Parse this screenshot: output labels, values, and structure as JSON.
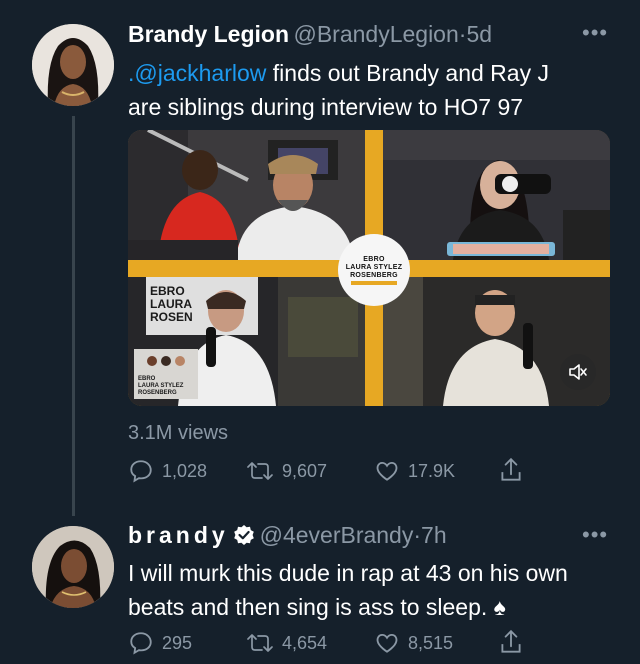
{
  "tweet1": {
    "name": "Brandy Legion",
    "handle": "@BrandyLegion",
    "separator": "·",
    "time": "5d",
    "mention": ".@jackharlow",
    "text_line1_rest": " finds out Brandy and Ray J",
    "text_line2": "are siblings during interview to HO7 97",
    "media": {
      "logo_lines": [
        "EBRO",
        "LAURA STYLEZ",
        "ROSENBERG"
      ],
      "sign_lines": [
        "EBRO",
        "LAURA",
        "ROSEN"
      ],
      "small_sign_lines": [
        "EBRO",
        "LAURA STYLEZ",
        "ROSENBERG"
      ]
    },
    "views": "3.1M views",
    "stats": {
      "replies": "1,028",
      "retweets": "9,607",
      "likes": "17.9K"
    }
  },
  "tweet2": {
    "name": "brandy",
    "handle": "@4everBrandy",
    "separator": "·",
    "time": "7h",
    "text_line1": "I will murk this dude in rap at 43 on his own",
    "text_line2": "beats and then sing is ass to sleep. ♠",
    "stats": {
      "replies": "295",
      "retweets": "4,654",
      "likes": "8,515"
    }
  },
  "icons": {
    "reply": "reply-icon",
    "retweet": "retweet-icon",
    "like": "heart-icon",
    "share": "share-icon",
    "mute": "mute-icon",
    "verified": "verified-badge-icon",
    "more": "more-icon"
  },
  "colors": {
    "background": "#15202b",
    "link": "#1d9bf0",
    "muted": "#8b98a5",
    "accent": "#e7a823"
  }
}
